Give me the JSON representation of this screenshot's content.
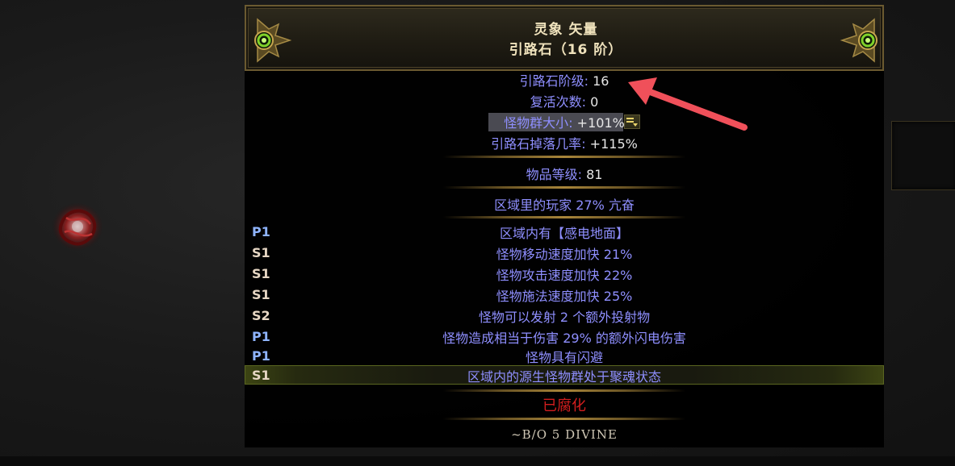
{
  "tooltip": {
    "name": "灵象 矢量",
    "base_type": "引路石（16 阶）",
    "properties": [
      {
        "label": "引路石阶级",
        "value": "16"
      },
      {
        "label": "复活次数",
        "value": "0"
      },
      {
        "label": "怪物群大小",
        "value": "+101%"
      },
      {
        "label": "引路石掉落几率",
        "value": "+115%"
      }
    ],
    "item_level": {
      "label": "物品等级",
      "value": "81"
    },
    "implicit": "区域里的玩家 27% 亢奋",
    "mods": [
      {
        "tag": "P1",
        "text": "区域内有【感电地面】"
      },
      {
        "tag": "S1",
        "text": "怪物移动速度加快 21%"
      },
      {
        "tag": "S1",
        "text": "怪物攻击速度加快 22%"
      },
      {
        "tag": "S1",
        "text": "怪物施法速度加快 25%"
      },
      {
        "tag": "S2",
        "text": "怪物可以发射 2 个额外投射物"
      },
      {
        "tag": "P1",
        "text": "怪物造成相当于伤害 29% 的额外闪电伤害"
      },
      {
        "tag": "P1",
        "text": "怪物具有闪避"
      },
      {
        "tag": "S1",
        "text": "区域内的源生怪物群处于聚魂状态"
      }
    ],
    "corrupted": "已腐化",
    "note": "~B/O 5 DIVINE"
  },
  "icons": {
    "item": "waystone-map-icon",
    "corner": "rare-corner-ornament-icon",
    "quantity": "item-quantity-icon",
    "annotation": "red-arrow-annotation"
  },
  "colors": {
    "property_label": "#8f8fff",
    "property_value": "#e6e6e6",
    "title": "#efe2bc",
    "corrupted": "#d21e1e",
    "prefix_tag": "#8fb4ff",
    "suffix_tag": "#e7d7c4",
    "annotation_arrow": "#f0505a"
  }
}
